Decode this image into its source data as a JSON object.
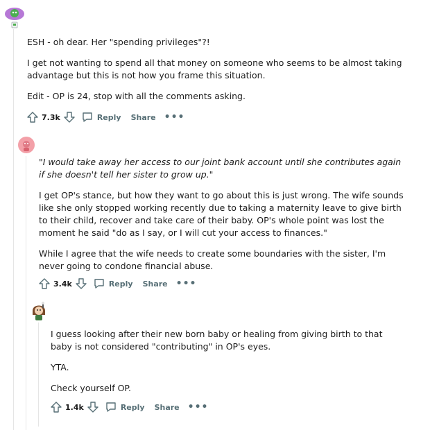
{
  "comments": [
    {
      "paragraphs": [
        "ESH - oh dear. Her \"spending privileges\"?!",
        "I get not wanting to spend all that money on someone who seems to be almost taking advantage but this is not how you frame this situation.",
        "Edit - OP is 24, stop with all the comments asking."
      ],
      "score": "7.3k",
      "reply_label": "Reply",
      "share_label": "Share",
      "more_label": "•••",
      "avatar_icon": "green-snoo-avatar-icon"
    },
    {
      "paragraphs": [
        "\"I would take away her access to our joint bank account until she contributes again if she doesn't tell her sister to grow up.\"",
        "I get OP's stance, but how they want to go about this is just wrong. The wife sounds like she only stopped working recently due to taking a maternity leave to give birth to their child, recover and take care of their baby. OP's whole point was lost the moment he said \"do as I say, or I will cut your access to finances.\"",
        "While I agree that the wife needs to create some boundaries with the sister, I'm never going to condone financial abuse."
      ],
      "score": "3.4k",
      "reply_label": "Reply",
      "share_label": "Share",
      "more_label": "•••",
      "avatar_icon": "pink-avatar-icon"
    },
    {
      "paragraphs": [
        "I guess looking after their new born baby or healing from giving birth to that baby is not considered \"contributing\" in OP's eyes.",
        "YTA.",
        "Check yourself OP."
      ],
      "score": "1.4k",
      "reply_label": "Reply",
      "share_label": "Share",
      "more_label": "•••",
      "avatar_icon": "brown-hair-avatar-icon"
    }
  ],
  "colors": {
    "meta_text": "#576f76",
    "thread_line": "#e5e5e5",
    "avatar_pink": "#f3a0a8",
    "avatar_purple": "#b678d6",
    "avatar_green": "#4caf50"
  }
}
